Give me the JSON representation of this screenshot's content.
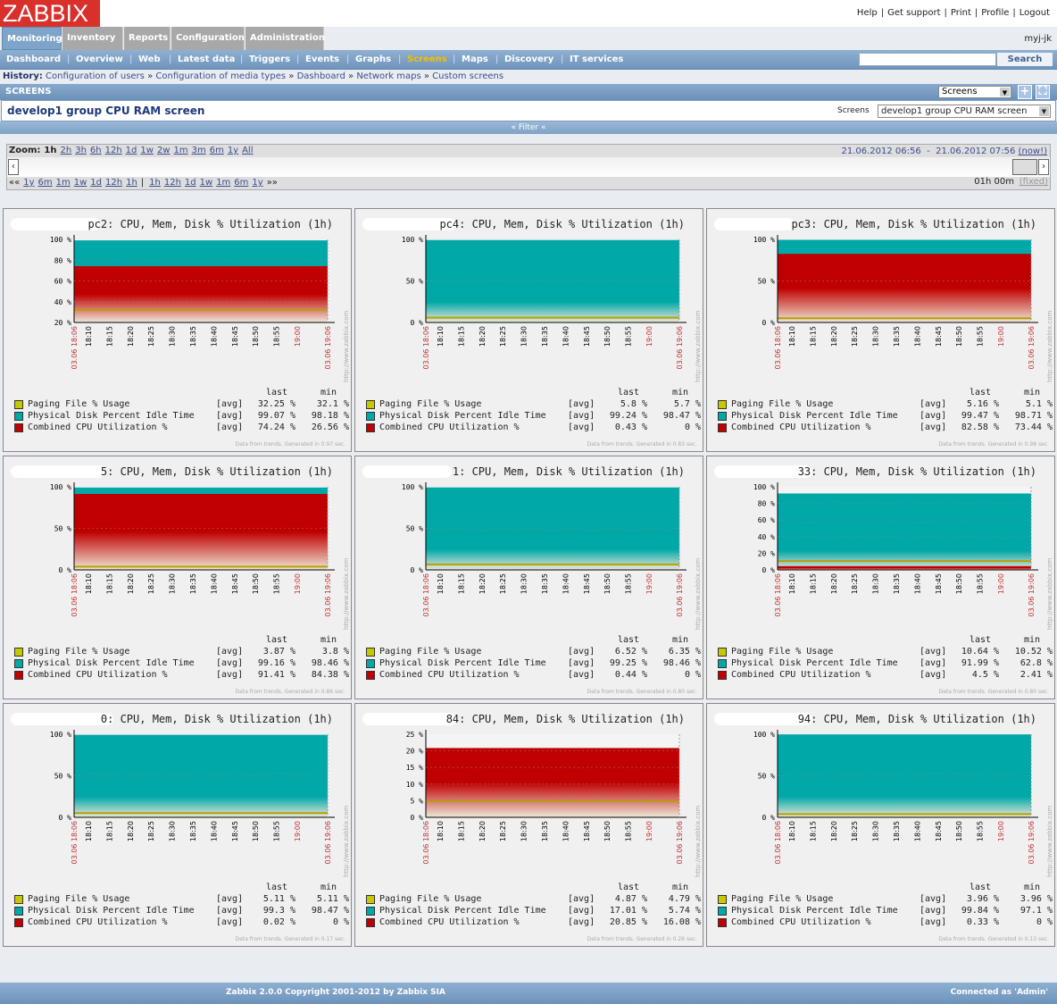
{
  "logo": "ZABBIX",
  "top_links": [
    "Help",
    "Get support",
    "Print",
    "Profile",
    "Logout"
  ],
  "main_menu": [
    "Monitoring",
    "Inventory",
    "Reports",
    "Configuration",
    "Administration"
  ],
  "user": "myj-jk",
  "sub_menu": [
    "Dashboard",
    "Overview",
    "Web",
    "Latest data",
    "Triggers",
    "Events",
    "Graphs",
    "Screens",
    "Maps",
    "Discovery",
    "IT services"
  ],
  "active_sub": "Screens",
  "search": {
    "value": "",
    "button": "Search"
  },
  "history": {
    "label": "History:",
    "items": [
      "Configuration of users",
      "Configuration of media types",
      "Dashboard",
      "Network maps",
      "Custom screens"
    ]
  },
  "section": "SCREENS",
  "view_select": "Screens",
  "screen_title": "develop1 group CPU RAM screen",
  "screens_label": "Screens",
  "screens_select": "develop1 group CPU RAM screen",
  "filter_label": "Filter",
  "zoom": {
    "label": "Zoom:",
    "options": [
      "1h",
      "2h",
      "3h",
      "6h",
      "12h",
      "1d",
      "1w",
      "2w",
      "1m",
      "3m",
      "6m",
      "1y",
      "All"
    ],
    "active": "1h",
    "back": [
      "1y",
      "6m",
      "1m",
      "1w",
      "1d",
      "12h",
      "1h"
    ],
    "fwd": [
      "1h",
      "12h",
      "1d",
      "1w",
      "1m",
      "6m",
      "1y"
    ],
    "from": "21.06.2012 06:56",
    "to": "21.06.2012 07:56",
    "now": "(now!)",
    "period": "01h 00m",
    "fixed": "(fixed)"
  },
  "legend_headers": [
    "last",
    "min"
  ],
  "series_names": [
    "Paging File % Usage",
    "Physical Disk  Percent Idle Time",
    "Combined CPU Utilization %"
  ],
  "series_colors": [
    "#c8c800",
    "#00a8a8",
    "#c00000"
  ],
  "x_ticks": [
    "18:10",
    "18:15",
    "18:20",
    "18:25",
    "18:30",
    "18:35",
    "18:40",
    "18:45",
    "18:50",
    "18:55",
    "19:00"
  ],
  "x_start": "03.06 18:06",
  "x_end": "03.06 19:06",
  "watermark": "http://www.zabbix.com",
  "graphs": [
    {
      "title": "pc2: CPU, Mem, Disk % Utilization (1h)",
      "ylim": [
        20,
        100
      ],
      "yticks": [
        "100 %",
        "80 %",
        "60 %",
        "40 %",
        "20 %"
      ],
      "last": [
        "32.25 %",
        "99.07 %",
        "74.24 %"
      ],
      "min": [
        "32.1 %",
        "98.18 %",
        "26.56 %"
      ],
      "gen": "Data from trends. Generated in 0.97 sec."
    },
    {
      "title": "pc4: CPU, Mem, Disk % Utilization (1h)",
      "ylim": [
        0,
        100
      ],
      "yticks": [
        "100 %",
        "50 %",
        "0 %"
      ],
      "last": [
        "5.8 %",
        "99.24 %",
        "0.43 %"
      ],
      "min": [
        "5.7 %",
        "98.47 %",
        "0 %"
      ],
      "gen": "Data from trends. Generated in 0.83 sec."
    },
    {
      "title": "pc3: CPU, Mem, Disk % Utilization (1h)",
      "ylim": [
        0,
        100
      ],
      "yticks": [
        "100 %",
        "50 %",
        "0 %"
      ],
      "last": [
        "5.16 %",
        "99.47 %",
        "82.58 %"
      ],
      "min": [
        "5.1 %",
        "98.71 %",
        "73.44 %"
      ],
      "gen": "Data from trends. Generated in 0.98 sec."
    },
    {
      "title": "5: CPU, Mem, Disk % Utilization (1h)",
      "ylim": [
        0,
        100
      ],
      "yticks": [
        "100 %",
        "50 %",
        "0 %"
      ],
      "last": [
        "3.87 %",
        "99.16 %",
        "91.41 %"
      ],
      "min": [
        "3.8 %",
        "98.46 %",
        "84.38 %"
      ],
      "gen": "Data from trends. Generated in 0.86 sec."
    },
    {
      "title": "1: CPU, Mem, Disk % Utilization (1h)",
      "ylim": [
        0,
        100
      ],
      "yticks": [
        "100 %",
        "50 %",
        "0 %"
      ],
      "last": [
        "6.52 %",
        "99.25 %",
        "0.44 %"
      ],
      "min": [
        "6.35 %",
        "98.46 %",
        "0 %"
      ],
      "gen": "Data from trends. Generated in 0.80 sec."
    },
    {
      "title": "33: CPU, Mem, Disk % Utilization (1h)",
      "ylim": [
        0,
        100
      ],
      "yticks": [
        "100 %",
        "80 %",
        "60 %",
        "40 %",
        "20 %",
        "0 %"
      ],
      "last": [
        "10.64 %",
        "91.99 %",
        "4.5 %"
      ],
      "min": [
        "10.52 %",
        "62.8 %",
        "2.41 %"
      ],
      "gen": "Data from trends. Generated in 0.80 sec."
    },
    {
      "title": "0: CPU, Mem, Disk % Utilization (1h)",
      "ylim": [
        0,
        100
      ],
      "yticks": [
        "100 %",
        "50 %",
        "0 %"
      ],
      "last": [
        "5.11 %",
        "99.3 %",
        "0.02 %"
      ],
      "min": [
        "5.11 %",
        "98.47 %",
        "0 %"
      ],
      "gen": "Data from trends. Generated in 0.17 sec."
    },
    {
      "title": "84: CPU, Mem, Disk % Utilization (1h)",
      "ylim": [
        0,
        25
      ],
      "yticks": [
        "25 %",
        "20 %",
        "15 %",
        "10 %",
        "5 %",
        "0 %"
      ],
      "last": [
        "4.87 %",
        "17.01 %",
        "20.85 %"
      ],
      "min": [
        "4.79 %",
        "5.74 %",
        "16.08 %"
      ],
      "gen": "Data from trends. Generated in 0.26 sec."
    },
    {
      "title": "94: CPU, Mem, Disk % Utilization (1h)",
      "ylim": [
        0,
        100
      ],
      "yticks": [
        "100 %",
        "50 %",
        "0 %"
      ],
      "last": [
        "3.96 %",
        "99.84 %",
        "0.33 %"
      ],
      "min": [
        "3.96 %",
        "97.1 %",
        "0 %"
      ],
      "gen": "Data from trends. Generated in 0.13 sec."
    }
  ],
  "footer": {
    "copyright": "Zabbix 2.0.0 Copyright 2001-2012 by Zabbix SIA",
    "connected": "Connected as 'Admin'"
  }
}
